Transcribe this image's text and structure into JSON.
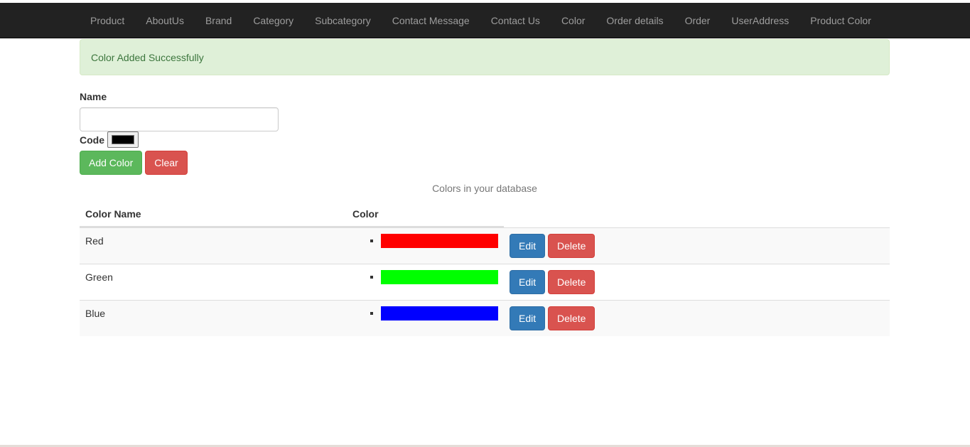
{
  "nav": {
    "items": [
      {
        "label": "Product"
      },
      {
        "label": "AboutUs"
      },
      {
        "label": "Brand"
      },
      {
        "label": "Category"
      },
      {
        "label": "Subcategory"
      },
      {
        "label": "Contact Message"
      },
      {
        "label": "Contact Us"
      },
      {
        "label": "Color"
      },
      {
        "label": "Order details"
      },
      {
        "label": "Order"
      },
      {
        "label": "UserAddress"
      },
      {
        "label": "Product Color"
      }
    ]
  },
  "alert": {
    "message": "Color Added Successfully"
  },
  "form": {
    "name_label": "Name",
    "name_value": "",
    "code_label": "Code",
    "code_value": "#000000",
    "add_label": "Add Color",
    "clear_label": "Clear"
  },
  "table": {
    "caption": "Colors in your database",
    "headers": {
      "name": "Color Name",
      "color": "Color"
    },
    "rows": [
      {
        "name": "Red",
        "color": "#ff0000",
        "edit_label": "Edit",
        "delete_label": "Delete"
      },
      {
        "name": "Green",
        "color": "#00ff00",
        "edit_label": "Edit",
        "delete_label": "Delete"
      },
      {
        "name": "Blue",
        "color": "#0000ff",
        "edit_label": "Edit",
        "delete_label": "Delete"
      }
    ]
  },
  "colors": {
    "navbar_bg": "#222222",
    "alert_bg": "#dff0d8",
    "success": "#5cb85c",
    "danger": "#d9534f",
    "primary": "#337ab7"
  }
}
